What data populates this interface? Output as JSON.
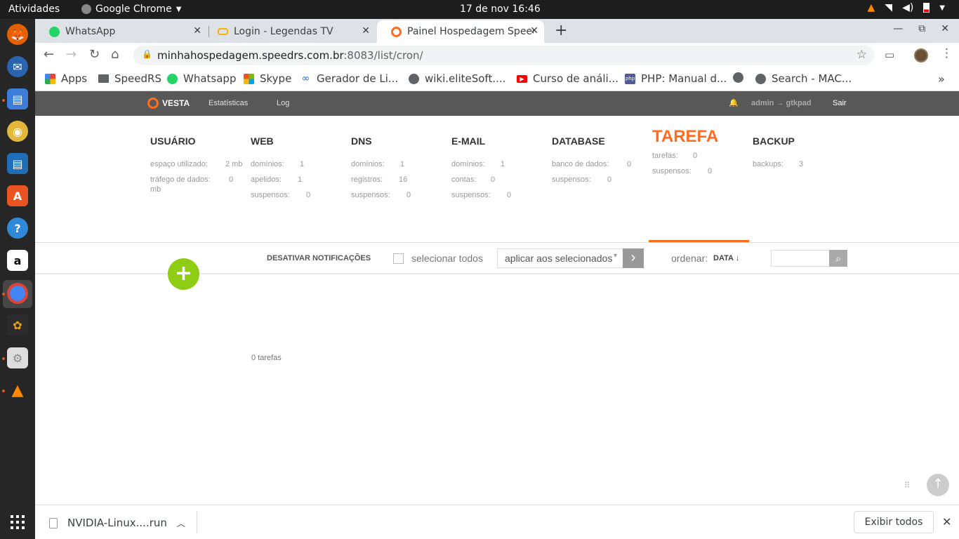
{
  "system": {
    "activities": "Atividades",
    "app_name": "Google Chrome",
    "clock": "17 de nov  16:46"
  },
  "tabs": [
    {
      "title": "WhatsApp"
    },
    {
      "title": "Login - Legendas TV"
    },
    {
      "title": "Painel Hospedagem Speedrs"
    }
  ],
  "address": {
    "host": "minhahospedagem.speedrs.com.br",
    "path": ":8083/list/cron/"
  },
  "bookmarks": [
    {
      "label": "Apps"
    },
    {
      "label": "SpeedRS"
    },
    {
      "label": "Whatsapp"
    },
    {
      "label": "Skype"
    },
    {
      "label": "Gerador de Li..."
    },
    {
      "label": "wiki.eliteSoft...."
    },
    {
      "label": "Curso de análi..."
    },
    {
      "label": "PHP: Manual d..."
    },
    {
      "label": ""
    },
    {
      "label": "Search - MAC..."
    }
  ],
  "vesta": {
    "logo": "VESTA",
    "menu": {
      "stats": "Estatísticas",
      "log": "Log"
    },
    "user": "admin → gtkpad",
    "logout": "Sair",
    "sections": [
      {
        "title": "USUÁRIO",
        "rows": [
          {
            "k": "espaço utilizado:",
            "v": "2 mb"
          },
          {
            "k": "tráfego de dados:",
            "v": "0"
          },
          {
            "k": "mb",
            "v": ""
          }
        ]
      },
      {
        "title": "WEB",
        "rows": [
          {
            "k": "domínios:",
            "v": "1"
          },
          {
            "k": "apelidos:",
            "v": "1"
          },
          {
            "k": "suspensos:",
            "v": "0"
          }
        ]
      },
      {
        "title": "DNS",
        "rows": [
          {
            "k": "domínios:",
            "v": "1"
          },
          {
            "k": "registros:",
            "v": "16"
          },
          {
            "k": "suspensos:",
            "v": "0"
          }
        ]
      },
      {
        "title": "E-MAIL",
        "rows": [
          {
            "k": "domínios:",
            "v": "1"
          },
          {
            "k": "contas:",
            "v": "0"
          },
          {
            "k": "suspensos:",
            "v": "0"
          }
        ]
      },
      {
        "title": "DATABASE",
        "rows": [
          {
            "k": "banco de dados:",
            "v": "0"
          },
          {
            "k": "suspensos:",
            "v": "0"
          }
        ]
      },
      {
        "title": "TAREFA",
        "rows": [
          {
            "k": "tarefas:",
            "v": "0"
          },
          {
            "k": "suspensos:",
            "v": "0"
          }
        ]
      },
      {
        "title": "BACKUP",
        "rows": [
          {
            "k": "backups:",
            "v": "3"
          }
        ]
      }
    ],
    "listbar": {
      "disable_notifications": "DESATIVAR NOTIFICAÇÕES",
      "select_all": "selecionar todos",
      "apply_placeholder": "aplicar aos selecionados",
      "order_label": "ordenar:",
      "order_value": "DATA ↓"
    },
    "count": "0 tarefas"
  },
  "downloads": {
    "file": "NVIDIA-Linux....run",
    "show_all": "Exibir todos"
  },
  "colors": {
    "accent": "#ff6d1f",
    "add_button": "#8fcc14",
    "header_bg": "#585858"
  }
}
